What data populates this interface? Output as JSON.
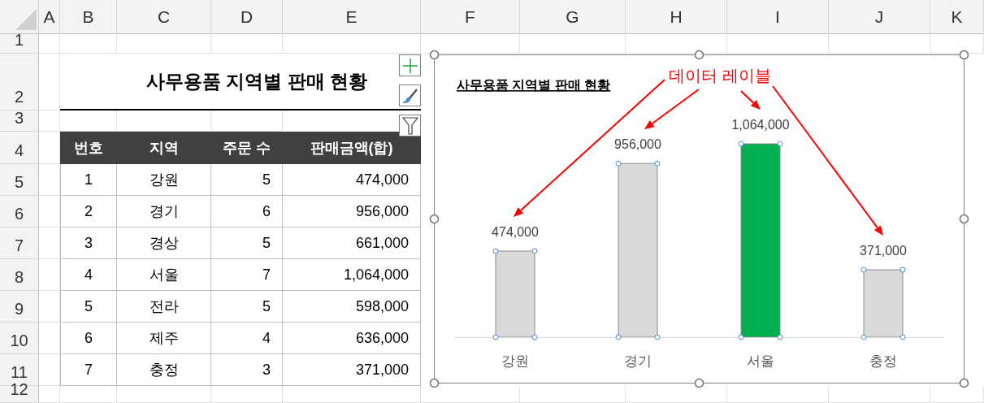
{
  "column_headers": [
    "A",
    "B",
    "C",
    "D",
    "E",
    "F",
    "G",
    "H",
    "I",
    "J",
    "K"
  ],
  "row_numbers": [
    "1",
    "2",
    "3",
    "4",
    "5",
    "6",
    "7",
    "8",
    "9",
    "10",
    "11",
    "12"
  ],
  "sheet_title": "사무용품 지역별 판매 현황",
  "table": {
    "columns": [
      "번호",
      "지역",
      "주문 수",
      "판매금액(합)"
    ],
    "rows": [
      [
        "1",
        "강원",
        "5",
        "474,000"
      ],
      [
        "2",
        "경기",
        "6",
        "956,000"
      ],
      [
        "3",
        "경상",
        "5",
        "661,000"
      ],
      [
        "4",
        "서울",
        "7",
        "1,064,000"
      ],
      [
        "5",
        "전라",
        "5",
        "598,000"
      ],
      [
        "6",
        "제주",
        "4",
        "636,000"
      ],
      [
        "7",
        "충정",
        "3",
        "371,000"
      ]
    ]
  },
  "chart": {
    "selected": true,
    "bars": [
      {
        "color": "#d9d9d9"
      },
      {
        "color": "#d9d9d9"
      },
      {
        "color": "#00b050"
      },
      {
        "color": "#d9d9d9"
      }
    ],
    "chart_data": {
      "type": "bar",
      "title": "사무용품 지역별 판매 현황",
      "categories": [
        "강원",
        "경기",
        "서울",
        "충정"
      ],
      "series": [
        {
          "values": [
            474000,
            956000,
            1064000,
            371000
          ],
          "value_labels": [
            "474,000",
            "956,000",
            "1,064,000",
            "371,000"
          ]
        }
      ],
      "data_labels": true,
      "annotations": [
        {
          "text": "데이터 레이블"
        }
      ]
    }
  }
}
